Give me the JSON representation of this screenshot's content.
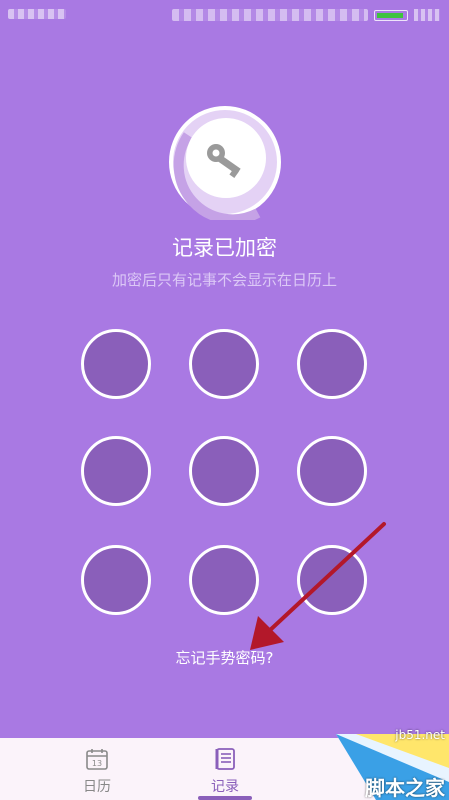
{
  "title": "记录已加密",
  "subtitle": "加密后只有记事不会显示在日历上",
  "forgot_label": "忘记手势密码?",
  "pattern": {
    "rows": 3,
    "cols": 3
  },
  "nav": {
    "items": [
      {
        "label": "日历",
        "icon": "calendar-icon",
        "calendar_day": "13"
      },
      {
        "label": "记录",
        "icon": "notes-icon"
      }
    ],
    "active_index": 1
  },
  "watermark": {
    "site": "jb51.net",
    "brand": "脚本之家"
  },
  "colors": {
    "background": "#a979e3",
    "dot_fill": "#8a5fba",
    "dot_border": "#ffffff",
    "arrow": "#b3182a",
    "nav_bg": "#fbf3fa",
    "battery": "#3ec23e"
  }
}
